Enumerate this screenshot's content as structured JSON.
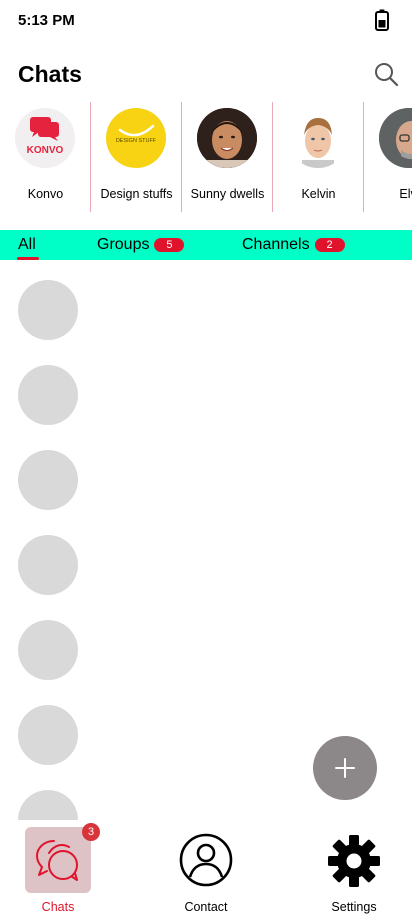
{
  "status_bar": {
    "time": "5:13 PM"
  },
  "header": {
    "title": "Chats"
  },
  "stories": [
    {
      "label": "Konvo",
      "logo_text": "KONVO"
    },
    {
      "label": "Design stuffs",
      "logo_text": "DESIGN STUFF"
    },
    {
      "label": "Sunny dwells"
    },
    {
      "label": "Kelvin"
    },
    {
      "label": "Elvi"
    }
  ],
  "tabs": [
    {
      "label": "All",
      "active": true
    },
    {
      "label": "Groups",
      "badge": "5"
    },
    {
      "label": "Channels",
      "badge": "2"
    }
  ],
  "fab": {
    "icon": "plus-icon"
  },
  "bottom_nav": [
    {
      "label": "Chats",
      "icon": "chat-bubbles-icon",
      "badge": "3",
      "active": true
    },
    {
      "label": "Contact",
      "icon": "person-icon"
    },
    {
      "label": "Settings",
      "icon": "gear-icon"
    }
  ],
  "colors": {
    "tab_bar": "#00ffc6",
    "accent_red": "#e0132c",
    "fab": "#8c8788",
    "active_nav_bg": "#ddc2c6",
    "placeholder": "#d9d9d9"
  }
}
